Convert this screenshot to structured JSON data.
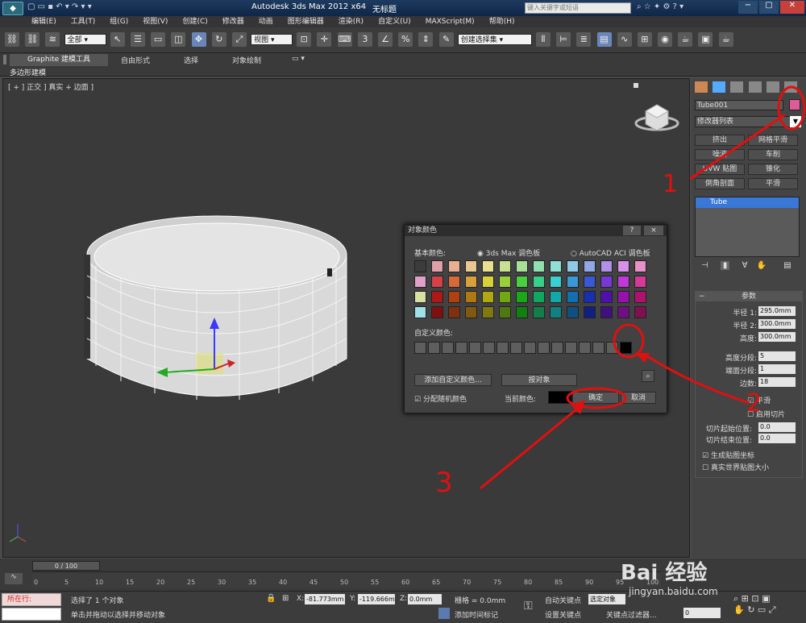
{
  "title_bar": {
    "app_title": "Autodesk 3ds Max 2012 x64",
    "doc_title": "无标题",
    "search_placeholder": "键入关键字或短语"
  },
  "menu": [
    "编辑(E)",
    "工具(T)",
    "组(G)",
    "视图(V)",
    "创建(C)",
    "修改器",
    "动画",
    "图形编辑器",
    "渲染(R)",
    "自定义(U)",
    "MAXScript(M)",
    "帮助(H)"
  ],
  "toolbar": {
    "selection_filter": "全部",
    "ref_coord": "视图",
    "named_set": "创建选择集"
  },
  "ribbon": {
    "tabs": [
      "Graphite 建模工具",
      "自由形式",
      "选择",
      "对象绘制"
    ],
    "sub_label": "多边形建模"
  },
  "viewport": {
    "label": "[ + ] 正交 ] 真实 + 边面 ]"
  },
  "dialog": {
    "title": "对象颜色",
    "help": "?",
    "close": "×",
    "basic_colors_label": "基本颜色:",
    "palette_3dsmax": "3ds Max 调色板",
    "palette_autocad": "AutoCAD ACI 调色板",
    "custom_colors_label": "自定义颜色:",
    "add_custom": "添加自定义颜色...",
    "by_object": "按对象",
    "assign_random": "分配随机颜色",
    "current_color_label": "当前颜色:",
    "ok": "确定",
    "cancel": "取消",
    "current_color": "#000000",
    "basic_colors": [
      [
        "#3c3c3c",
        "#e0a0a8",
        "#e8b090",
        "#e8c890",
        "#e8e090",
        "#c8e090",
        "#a8e098",
        "#90e0b0",
        "#90e0d8",
        "#90c8e8",
        "#90a8e8",
        "#b090e8",
        "#d890e8",
        "#e890c8"
      ],
      [
        "#e0a0c8",
        "#d84048",
        "#d86838",
        "#d8a038",
        "#d8d038",
        "#98d038",
        "#48d040",
        "#38d088",
        "#38d0d0",
        "#3898d8",
        "#3858d8",
        "#7838d8",
        "#c038d8",
        "#d83898"
      ],
      [
        "#d8e0a0",
        "#b01818",
        "#b04010",
        "#b07810",
        "#b0a810",
        "#70a810",
        "#18a818",
        "#10a860",
        "#10a8a8",
        "#1070b0",
        "#1830b0",
        "#5010b0",
        "#9810b0",
        "#b01070"
      ],
      [
        "#a0e0e8",
        "#801010",
        "#803010",
        "#805810",
        "#807810",
        "#507810",
        "#108010",
        "#108048",
        "#108080",
        "#105080",
        "#102080",
        "#401080",
        "#701080",
        "#801050"
      ]
    ]
  },
  "command_panel": {
    "object_name": "Tube001",
    "object_color": "#e05a9a",
    "modifier_list": "修改器列表",
    "modifier_buttons": [
      "挤出",
      "网格平滑",
      "噪波",
      "车削",
      "UVW 贴图",
      "锥化",
      "倒角剖面",
      "平滑"
    ],
    "stack_item": "Tube",
    "rollout_title": "参数",
    "params": [
      {
        "label": "半径 1:",
        "value": "295.0mm"
      },
      {
        "label": "半径 2:",
        "value": "300.0mm"
      },
      {
        "label": "高度:",
        "value": "300.0mm"
      },
      {
        "label": "高度分段:",
        "value": "5"
      },
      {
        "label": "端面分段:",
        "value": "1"
      },
      {
        "label": "边数:",
        "value": "18"
      }
    ],
    "smooth": "平滑",
    "slice_on": "启用切片",
    "slice_from": {
      "label": "切片起始位置:",
      "value": "0.0"
    },
    "slice_to": {
      "label": "切片结束位置:",
      "value": "0.0"
    },
    "gen_map": "生成贴图坐标",
    "real_world": "真实世界贴图大小"
  },
  "timeline": {
    "frame": "0 / 100",
    "ticks": [
      "0",
      "5",
      "10",
      "15",
      "20",
      "25",
      "30",
      "35",
      "40",
      "45",
      "50",
      "55",
      "60",
      "65",
      "70",
      "75",
      "80",
      "85",
      "90",
      "95",
      "100"
    ]
  },
  "status": {
    "now": "所在行:",
    "selected": "选择了 1 个对象",
    "hint": "单击并拖动以选择并移动对象",
    "x": "-81.773mm",
    "y": "-119.666m",
    "z": "0.0mm",
    "grid": "栅格 = 0.0mm",
    "add_time_tag": "添加时间标记",
    "auto_key": "自动关键点",
    "set_key": "设置关键点",
    "selected_obj": "选定对象",
    "key_filters": "关键点过滤器...",
    "frame_field": "0"
  },
  "annotations": [
    "1",
    "2",
    "3"
  ],
  "watermark": {
    "brand": "Bai 经验",
    "url": "jingyan.baidu.com"
  }
}
